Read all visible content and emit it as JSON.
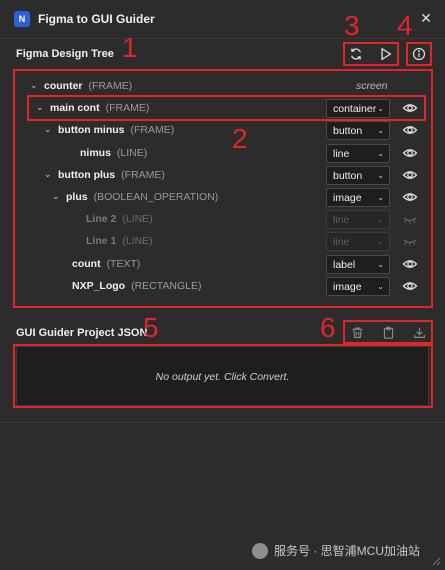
{
  "window": {
    "title": "Figma to GUI Guider",
    "icon_text": "N",
    "close_glyph": "✕"
  },
  "tree_section": {
    "title": "Figma Design Tree"
  },
  "json_section": {
    "title": "GUI Guider Project JSON",
    "placeholder": "No output yet. Click Convert."
  },
  "annotations": [
    "1",
    "2",
    "3",
    "4",
    "5",
    "6"
  ],
  "toolbar": {
    "refresh_icon": "refresh-icon",
    "convert_icon": "play-icon",
    "info_icon": "info-icon",
    "clear_icon": "trash-icon",
    "copy_icon": "clipboard-icon",
    "download_icon": "download-icon"
  },
  "tree": [
    {
      "name": "counter",
      "kind": "(FRAME)",
      "tag": "screen",
      "type": null,
      "disabled": false,
      "chevron": "⌄"
    },
    {
      "name": "main cont",
      "kind": "(FRAME)",
      "tag": null,
      "type": "container",
      "disabled": false,
      "chevron": "⌄"
    },
    {
      "name": "button minus",
      "kind": "(FRAME)",
      "tag": null,
      "type": "button",
      "disabled": false,
      "chevron": "⌄"
    },
    {
      "name": "nimus",
      "kind": "(LINE)",
      "tag": null,
      "type": "line",
      "disabled": false,
      "chevron": ""
    },
    {
      "name": "button plus",
      "kind": "(FRAME)",
      "tag": null,
      "type": "button",
      "disabled": false,
      "chevron": "⌄"
    },
    {
      "name": "plus",
      "kind": "(BOOLEAN_OPERATION)",
      "tag": null,
      "type": "image",
      "disabled": false,
      "chevron": "⌄"
    },
    {
      "name": "Line 2",
      "kind": "(LINE)",
      "tag": null,
      "type": "line",
      "disabled": true,
      "chevron": ""
    },
    {
      "name": "Line 1",
      "kind": "(LINE)",
      "tag": null,
      "type": "line",
      "disabled": true,
      "chevron": ""
    },
    {
      "name": "count",
      "kind": "(TEXT)",
      "tag": null,
      "type": "label",
      "disabled": false,
      "chevron": ""
    },
    {
      "name": "NXP_Logo",
      "kind": "(RECTANGLE)",
      "tag": null,
      "type": "image",
      "disabled": false,
      "chevron": ""
    }
  ],
  "caret_glyph": "⌄",
  "watermark": {
    "text": "服务号 · 思智浦MCU加油站"
  },
  "colors": {
    "annotation_red": "#e0262a",
    "background": "#2c2c2c",
    "brand_blue": "#2a61d6"
  }
}
